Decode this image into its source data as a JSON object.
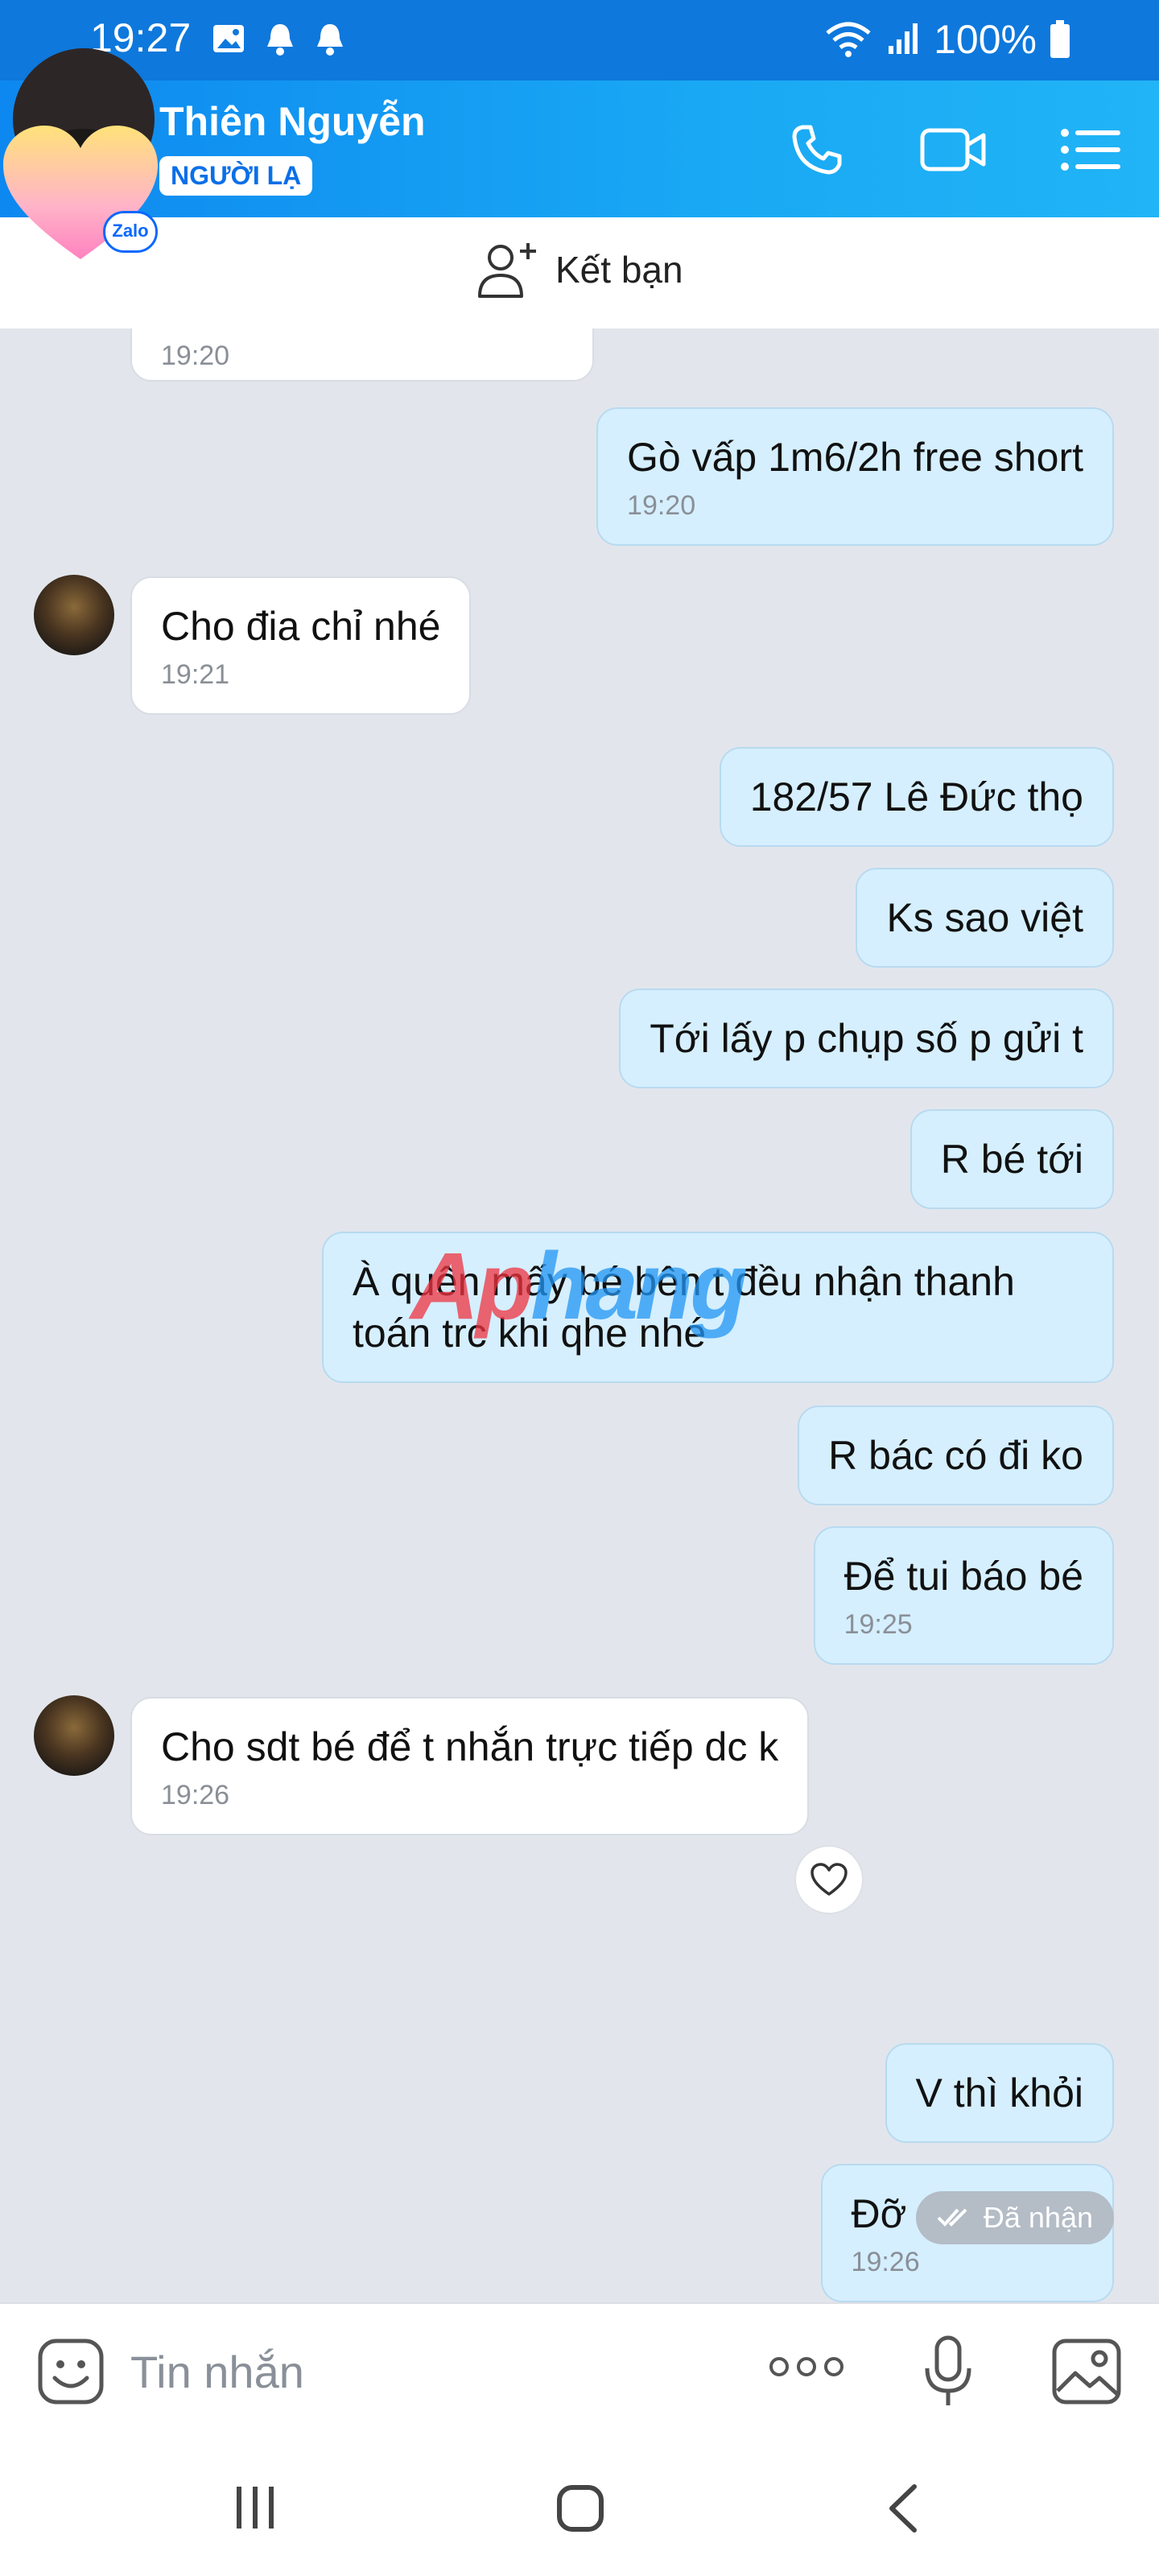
{
  "status_bar": {
    "time": "19:27",
    "battery": "100%"
  },
  "header": {
    "contact_name": "Thiên Nguyễn",
    "badge": "NGƯỜI LẠ",
    "zalo_badge": "Zalo"
  },
  "add_friend": {
    "label": "Kết bạn"
  },
  "messages": [
    {
      "direction": "in",
      "text": "",
      "time": "19:20"
    },
    {
      "direction": "out",
      "text": "Gò vấp 1m6/2h free short",
      "time": "19:20"
    },
    {
      "direction": "in",
      "text": "Cho đia chỉ nhé",
      "time": "19:21"
    },
    {
      "direction": "out",
      "text": "182/57 Lê Đức thọ",
      "time": ""
    },
    {
      "direction": "out",
      "text": "Ks sao việt",
      "time": ""
    },
    {
      "direction": "out",
      "text": "Tới lấy p chụp số p gửi t",
      "time": ""
    },
    {
      "direction": "out",
      "text": "R bé tới",
      "time": ""
    },
    {
      "direction": "out",
      "text": "À quên mấy bé bên t đều nhận thanh toán trc khi qhe nhé",
      "time": ""
    },
    {
      "direction": "out",
      "text": "R bác có đi ko",
      "time": ""
    },
    {
      "direction": "out",
      "text": "Để tui báo bé",
      "time": "19:25"
    },
    {
      "direction": "in",
      "text": "Cho sdt bé để t nhắn trực tiếp dc k",
      "time": "19:26"
    },
    {
      "direction": "out",
      "text": "V thì khỏi",
      "time": ""
    },
    {
      "direction": "out",
      "text": "Đỡ mất tgian",
      "time": "19:26"
    }
  ],
  "received_status": "Đã nhận",
  "watermark": {
    "part1": "Ap",
    "part2": "hang"
  },
  "input": {
    "placeholder": "Tin nhắn"
  },
  "colors": {
    "header_blue": "#0d88f0",
    "outgoing_bubble": "#d5efff",
    "incoming_bubble": "#ffffff",
    "chat_bg": "#e2e6ec"
  },
  "icons": [
    "image-icon",
    "bell-icon",
    "wifi-icon",
    "signal-icon",
    "battery-icon",
    "phone-icon",
    "video-call-icon",
    "list-menu-icon",
    "add-friend-icon",
    "heart-icon",
    "check-icon",
    "emoji-icon",
    "more-icon",
    "mic-icon",
    "gallery-icon",
    "recent-apps-icon",
    "home-icon",
    "back-icon"
  ]
}
